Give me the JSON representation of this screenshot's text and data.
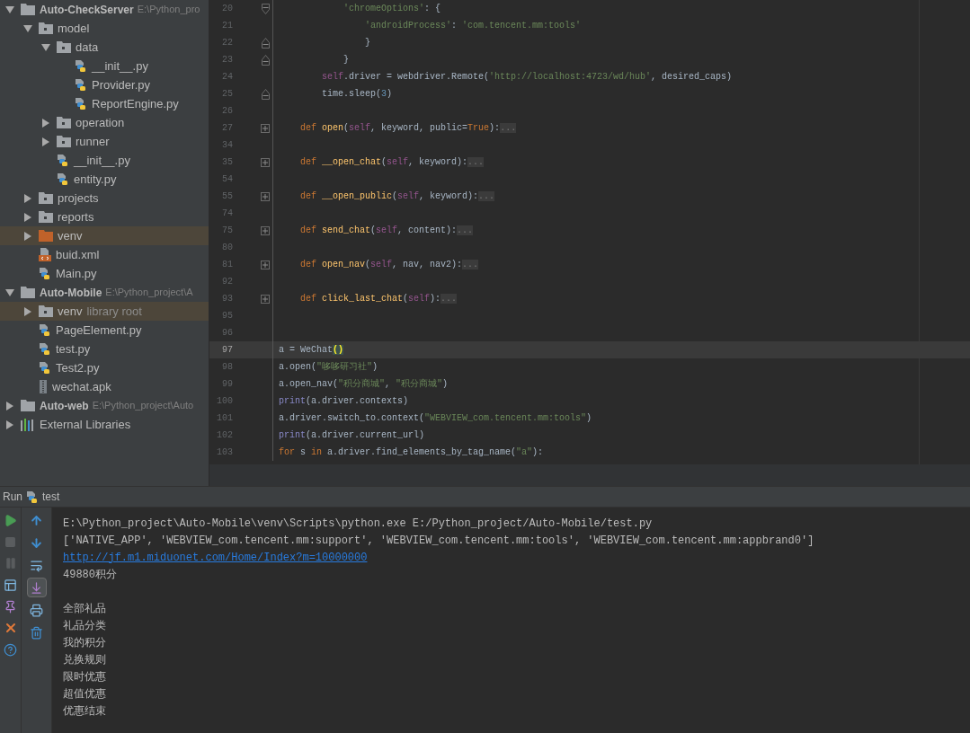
{
  "project_tree": [
    {
      "label": "Auto-CheckServer",
      "path": "E:\\Python_pro",
      "kind": "project",
      "expanded": true,
      "highlighted": false,
      "children": [
        {
          "label": "model",
          "kind": "folder",
          "expanded": true,
          "highlighted": false,
          "children": [
            {
              "label": "data",
              "kind": "folder",
              "expanded": true,
              "highlighted": false,
              "children": [
                {
                  "label": "__init__.py",
                  "kind": "python",
                  "highlighted": false
                },
                {
                  "label": "Provider.py",
                  "kind": "python",
                  "highlighted": false
                },
                {
                  "label": "ReportEngine.py",
                  "kind": "python",
                  "highlighted": false
                }
              ]
            },
            {
              "label": "operation",
              "kind": "folder",
              "expanded": false,
              "highlighted": false
            },
            {
              "label": "runner",
              "kind": "folder",
              "expanded": false,
              "highlighted": false
            },
            {
              "label": "__init__.py",
              "kind": "python",
              "highlighted": false
            },
            {
              "label": "entity.py",
              "kind": "python",
              "highlighted": false
            }
          ]
        },
        {
          "label": "projects",
          "kind": "folder",
          "expanded": false,
          "highlighted": false
        },
        {
          "label": "reports",
          "kind": "folder",
          "expanded": false,
          "highlighted": false
        },
        {
          "label": "venv",
          "kind": "excluded",
          "expanded": false,
          "highlighted": true
        },
        {
          "label": "buid.xml",
          "kind": "xml",
          "highlighted": false
        },
        {
          "label": "Main.py",
          "kind": "python",
          "highlighted": false
        }
      ]
    },
    {
      "label": "Auto-Mobile",
      "path": "E:\\Python_project\\A",
      "kind": "project",
      "expanded": true,
      "highlighted": false,
      "children": [
        {
          "label": "venv",
          "note": "library root",
          "kind": "folder",
          "expanded": false,
          "highlighted": true
        },
        {
          "label": "PageElement.py",
          "kind": "python",
          "highlighted": false
        },
        {
          "label": "test.py",
          "kind": "python",
          "highlighted": false
        },
        {
          "label": "Test2.py",
          "kind": "python",
          "highlighted": false
        },
        {
          "label": "wechat.apk",
          "kind": "archive",
          "highlighted": false
        }
      ]
    },
    {
      "label": "Auto-web",
      "path": "E:\\Python_project\\Auto",
      "kind": "project",
      "expanded": false,
      "highlighted": false
    },
    {
      "label": "External Libraries",
      "kind": "libraries",
      "expanded": false,
      "highlighted": false
    }
  ],
  "editor": {
    "lines": [
      {
        "number": "20",
        "kind": "fold_open",
        "current": false,
        "tokens": [
          {
            "text": "            'chromeOptions'",
            "kind": "string"
          },
          {
            "text": ": {",
            "kind": "plain"
          }
        ]
      },
      {
        "number": "21",
        "kind": "plain",
        "current": false,
        "tokens": [
          {
            "text": "                'androidProcess'",
            "kind": "string"
          },
          {
            "text": ": ",
            "kind": "plain"
          },
          {
            "text": "'com.tencent.mm:tools'",
            "kind": "string"
          }
        ]
      },
      {
        "number": "22",
        "kind": "fold_close",
        "current": false,
        "tokens": [
          {
            "text": "                }",
            "kind": "plain"
          }
        ]
      },
      {
        "number": "23",
        "kind": "fold_close",
        "current": false,
        "tokens": [
          {
            "text": "            }",
            "kind": "plain"
          }
        ]
      },
      {
        "number": "24",
        "kind": "plain",
        "current": false,
        "tokens": [
          {
            "text": "        self",
            "kind": "self"
          },
          {
            "text": ".driver = webdriver.Remote(",
            "kind": "plain"
          },
          {
            "text": "'http://localhost:4723/wd/hub'",
            "kind": "string"
          },
          {
            "text": ", desired_caps)",
            "kind": "plain"
          }
        ]
      },
      {
        "number": "25",
        "kind": "fold_close",
        "current": false,
        "tokens": [
          {
            "text": "        time.sleep(",
            "kind": "plain"
          },
          {
            "text": "3",
            "kind": "number"
          },
          {
            "text": ")",
            "kind": "plain"
          }
        ]
      },
      {
        "number": "26",
        "kind": "plain",
        "current": false
      },
      {
        "number": "27",
        "kind": "fold_collapsed",
        "current": false,
        "tokens": [
          {
            "text": "    def ",
            "kind": "keyword"
          },
          {
            "text": "open",
            "kind": "function"
          },
          {
            "text": "(",
            "kind": "plain"
          },
          {
            "text": "self",
            "kind": "self"
          },
          {
            "text": ", keyword, public=",
            "kind": "plain"
          },
          {
            "text": "True",
            "kind": "keyword"
          },
          {
            "text": "):",
            "kind": "plain"
          },
          {
            "text": "...",
            "kind": "folded"
          }
        ]
      },
      {
        "number": "34",
        "kind": "plain",
        "current": false
      },
      {
        "number": "35",
        "kind": "fold_collapsed",
        "current": false,
        "tokens": [
          {
            "text": "    def ",
            "kind": "keyword"
          },
          {
            "text": "__open_chat",
            "kind": "function"
          },
          {
            "text": "(",
            "kind": "plain"
          },
          {
            "text": "self",
            "kind": "self"
          },
          {
            "text": ", keyword):",
            "kind": "plain"
          },
          {
            "text": "...",
            "kind": "folded"
          }
        ]
      },
      {
        "number": "54",
        "kind": "plain",
        "current": false
      },
      {
        "number": "55",
        "kind": "fold_collapsed",
        "current": false,
        "tokens": [
          {
            "text": "    def ",
            "kind": "keyword"
          },
          {
            "text": "__open_public",
            "kind": "function"
          },
          {
            "text": "(",
            "kind": "plain"
          },
          {
            "text": "self",
            "kind": "self"
          },
          {
            "text": ", keyword):",
            "kind": "plain"
          },
          {
            "text": "...",
            "kind": "folded"
          }
        ]
      },
      {
        "number": "74",
        "kind": "plain",
        "current": false
      },
      {
        "number": "75",
        "kind": "fold_collapsed",
        "current": false,
        "tokens": [
          {
            "text": "    def ",
            "kind": "keyword"
          },
          {
            "text": "send_chat",
            "kind": "function"
          },
          {
            "text": "(",
            "kind": "plain"
          },
          {
            "text": "self",
            "kind": "self"
          },
          {
            "text": ", content):",
            "kind": "plain"
          },
          {
            "text": "...",
            "kind": "folded"
          }
        ]
      },
      {
        "number": "80",
        "kind": "plain",
        "current": false
      },
      {
        "number": "81",
        "kind": "fold_collapsed",
        "current": false,
        "tokens": [
          {
            "text": "    def ",
            "kind": "keyword"
          },
          {
            "text": "open_nav",
            "kind": "function"
          },
          {
            "text": "(",
            "kind": "plain"
          },
          {
            "text": "self",
            "kind": "self"
          },
          {
            "text": ", nav, nav2):",
            "kind": "plain"
          },
          {
            "text": "...",
            "kind": "folded"
          }
        ]
      },
      {
        "number": "92",
        "kind": "plain",
        "current": false
      },
      {
        "number": "93",
        "kind": "fold_collapsed",
        "current": false,
        "tokens": [
          {
            "text": "    def ",
            "kind": "keyword"
          },
          {
            "text": "click_last_chat",
            "kind": "function"
          },
          {
            "text": "(",
            "kind": "plain"
          },
          {
            "text": "self",
            "kind": "self"
          },
          {
            "text": "):",
            "kind": "plain"
          },
          {
            "text": "...",
            "kind": "folded"
          }
        ]
      },
      {
        "number": "95",
        "kind": "plain",
        "current": false
      },
      {
        "number": "96",
        "kind": "plain",
        "current": false
      },
      {
        "number": "97",
        "kind": "plain",
        "current": true,
        "tokens": [
          {
            "text": "a = WeChat",
            "kind": "plain"
          },
          {
            "text": "()",
            "kind": "match"
          }
        ]
      },
      {
        "number": "98",
        "kind": "plain",
        "current": false,
        "tokens": [
          {
            "text": "a.open(",
            "kind": "plain"
          },
          {
            "text": "\"哆哆研习社\"",
            "kind": "string"
          },
          {
            "text": ")",
            "kind": "plain"
          }
        ]
      },
      {
        "number": "99",
        "kind": "plain",
        "current": false,
        "tokens": [
          {
            "text": "a.open_nav(",
            "kind": "plain"
          },
          {
            "text": "\"积分商城\"",
            "kind": "string"
          },
          {
            "text": ", ",
            "kind": "plain"
          },
          {
            "text": "\"积分商城\"",
            "kind": "string"
          },
          {
            "text": ")",
            "kind": "plain"
          }
        ]
      },
      {
        "number": "100",
        "kind": "plain",
        "current": false,
        "tokens": [
          {
            "text": "print",
            "kind": "builtin"
          },
          {
            "text": "(a.driver.contexts)",
            "kind": "plain"
          }
        ]
      },
      {
        "number": "101",
        "kind": "plain",
        "current": false,
        "tokens": [
          {
            "text": "a.driver.switch_to.context(",
            "kind": "plain"
          },
          {
            "text": "\"WEBVIEW_com.tencent.mm:tools\"",
            "kind": "string"
          },
          {
            "text": ")",
            "kind": "plain"
          }
        ]
      },
      {
        "number": "102",
        "kind": "plain",
        "current": false,
        "tokens": [
          {
            "text": "print",
            "kind": "builtin"
          },
          {
            "text": "(a.driver.current_url)",
            "kind": "plain"
          }
        ]
      },
      {
        "number": "103",
        "kind": "plain",
        "current": false,
        "tokens": [
          {
            "text": "for ",
            "kind": "keyword"
          },
          {
            "text": "s ",
            "kind": "plain"
          },
          {
            "text": "in ",
            "kind": "keyword"
          },
          {
            "text": "a.driver.find_elements_by_tag_name(",
            "kind": "plain"
          },
          {
            "text": "\"a\"",
            "kind": "string"
          },
          {
            "text": "):",
            "kind": "plain"
          }
        ]
      }
    ]
  },
  "run_panel": {
    "title": "Run",
    "tab": "test",
    "scroll_to_end": true,
    "console": [
      {
        "kind": "text",
        "text": "E:\\Python_project\\Auto-Mobile\\venv\\Scripts\\python.exe E:/Python_project/Auto-Mobile/test.py"
      },
      {
        "kind": "text",
        "text": "['NATIVE_APP', 'WEBVIEW_com.tencent.mm:support', 'WEBVIEW_com.tencent.mm:tools', 'WEBVIEW_com.tencent.mm:appbrand0']"
      },
      {
        "kind": "link",
        "text": "http://jf.m1.miduonet.com/Home/Index?m=10000000"
      },
      {
        "kind": "text",
        "text": "49880积分"
      },
      {
        "kind": "blank"
      },
      {
        "kind": "text",
        "text": "全部礼品"
      },
      {
        "kind": "text",
        "text": "礼品分类"
      },
      {
        "kind": "text",
        "text": "我的积分"
      },
      {
        "kind": "text",
        "text": "兑换规则"
      },
      {
        "kind": "text",
        "text": "限时优惠"
      },
      {
        "kind": "text",
        "text": "超值优惠"
      },
      {
        "kind": "text",
        "text": "优惠结束"
      }
    ]
  }
}
